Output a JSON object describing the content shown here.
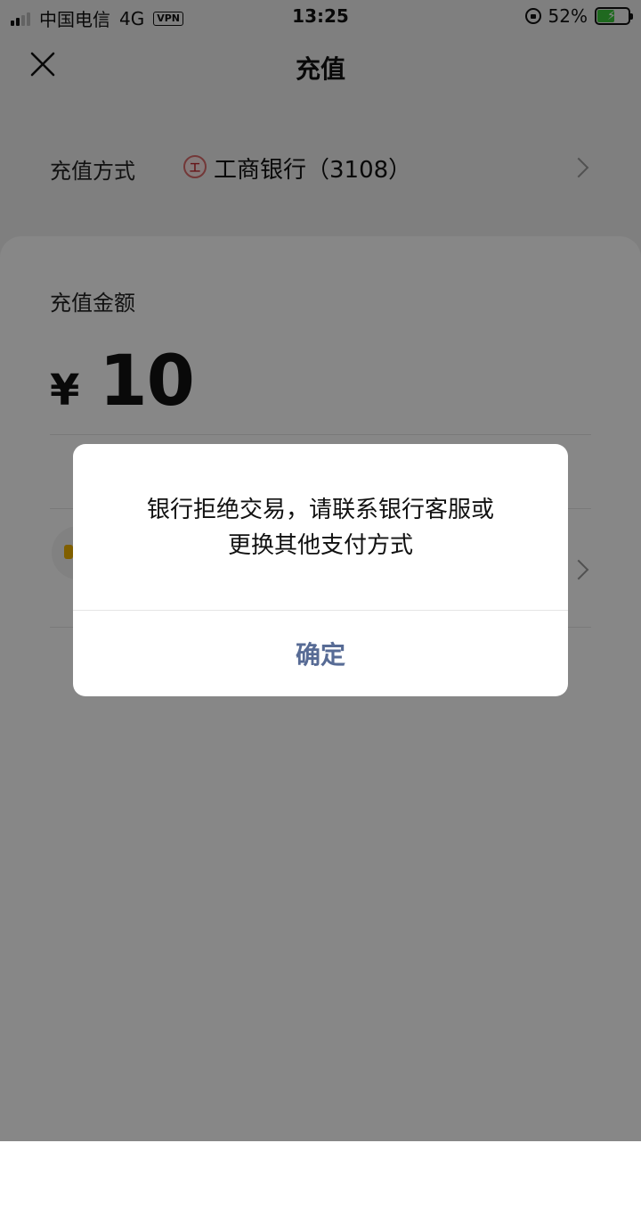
{
  "status_bar": {
    "carrier": "中国电信",
    "network": "4G",
    "vpn": "VPN",
    "time": "13:25",
    "battery": "52%",
    "battery_level": 0.52
  },
  "header": {
    "title": "充值",
    "close_icon": "close-icon"
  },
  "recharge_method": {
    "label": "充值方式",
    "bank_logo_icon": "icbc-logo-icon",
    "bank_name": "工商银行（3108）"
  },
  "recharge_amount": {
    "label": "充值金额",
    "currency": "¥",
    "value": "10"
  },
  "dialog": {
    "message_line1": "银行拒绝交易，请联系银行客服或",
    "message_line2": "更换其他支付方式",
    "confirm_label": "确定"
  },
  "colors": {
    "link_blue": "#576b95",
    "battery_green": "#3cc63c",
    "icbc_red": "#c1272d"
  }
}
